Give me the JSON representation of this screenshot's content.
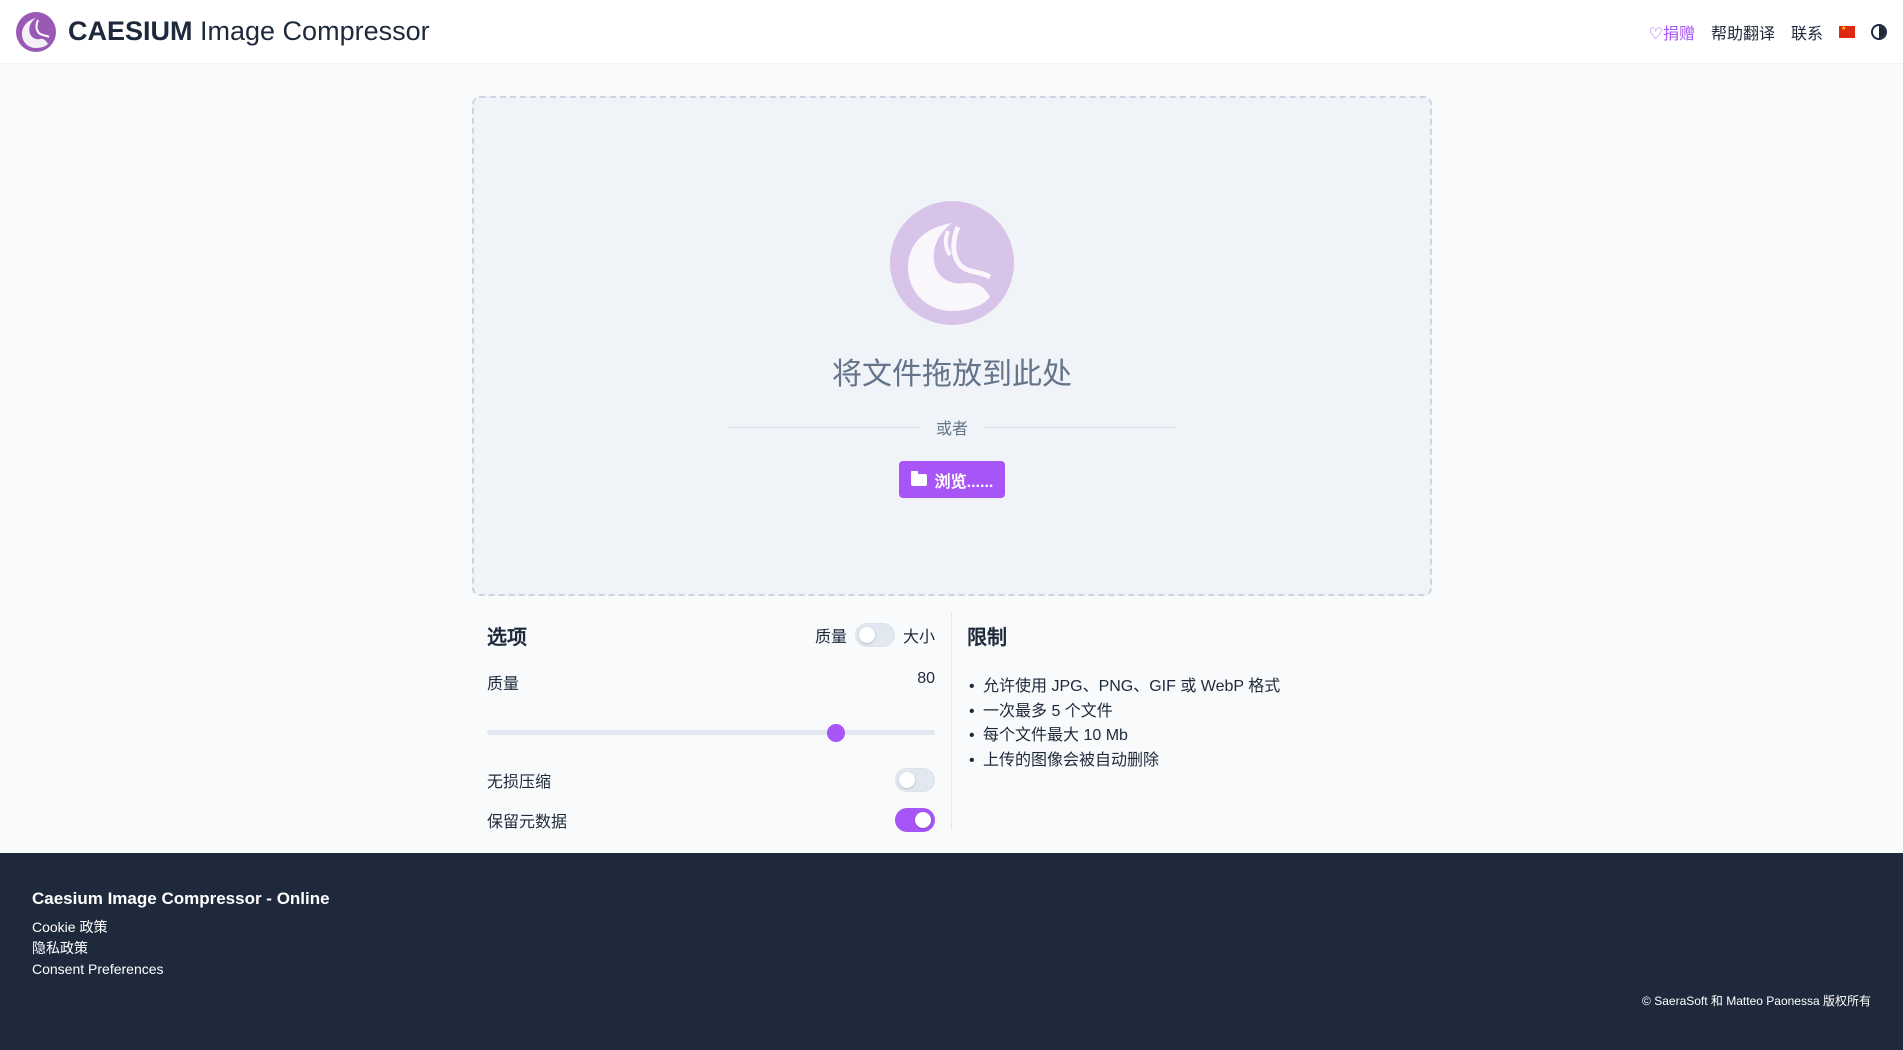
{
  "header": {
    "brand_bold": "CAESIUM",
    "brand_rest": " Image Compressor",
    "nav": {
      "donate": "♡捐赠",
      "help_translate": "帮助翻译",
      "contact": "联系"
    },
    "language_flag": "china-flag-icon",
    "theme_icon": "contrast-icon"
  },
  "dropzone": {
    "title": "将文件拖放到此处",
    "or": "或者",
    "browse": "浏览......"
  },
  "options": {
    "title": "选项",
    "mode_quality": "质量",
    "mode_size": "大小",
    "mode_toggle_on": false,
    "quality_label": "质量",
    "quality_value": "80",
    "slider_fraction": 0.78,
    "lossless_label": "无损压缩",
    "lossless_on": false,
    "keep_metadata_label": "保留元数据",
    "keep_metadata_on": true
  },
  "limits": {
    "title": "限制",
    "items": [
      "允许使用 JPG、PNG、GIF 或 WebP 格式",
      "一次最多 5 个文件",
      "每个文件最大 10 Mb",
      "上传的图像会被自动删除"
    ]
  },
  "footer": {
    "title": "Caesium Image Compressor - Online",
    "links": [
      "Cookie 政策",
      "隐私政策",
      "Consent Preferences"
    ],
    "copyright": "© SaeraSoft 和 Matteo Paonessa 版权所有"
  },
  "colors": {
    "accent": "#a855f7",
    "footer_bg": "#1e293b"
  }
}
